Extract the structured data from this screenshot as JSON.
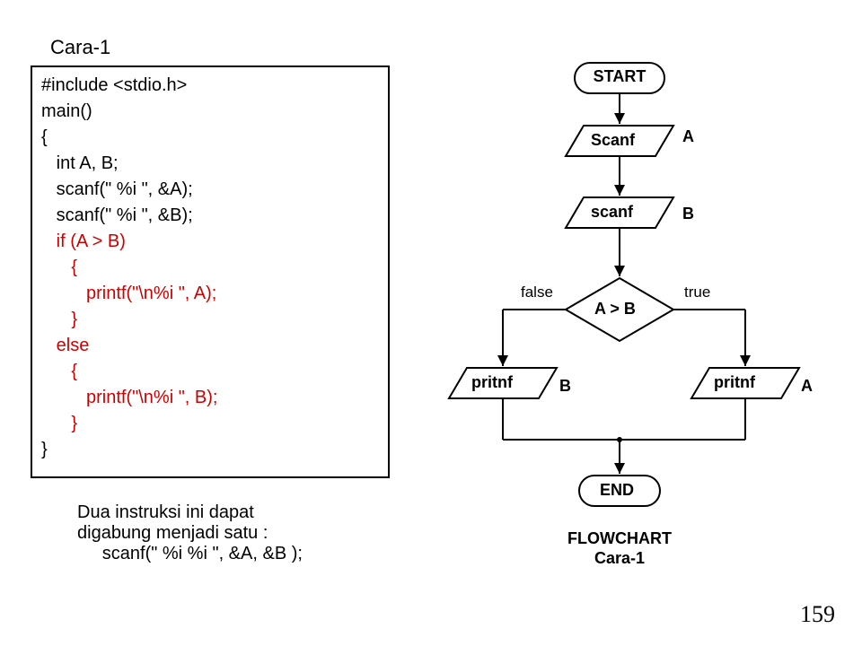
{
  "title": "Cara-1",
  "code_lines": [
    {
      "t": "#include <stdio.h>",
      "red": false,
      "indent": 0
    },
    {
      "t": "main()",
      "red": false,
      "indent": 0
    },
    {
      "t": "{",
      "red": false,
      "indent": 0
    },
    {
      "t": "int A, B;",
      "red": false,
      "indent": 1
    },
    {
      "t": "scanf(\" %i \", &A);",
      "red": false,
      "indent": 1
    },
    {
      "t": "scanf(\" %i \", &B);",
      "red": false,
      "indent": 1
    },
    {
      "t": "if (A > B)",
      "red": true,
      "indent": 1
    },
    {
      "t": "{",
      "red": true,
      "indent": 2
    },
    {
      "t": "printf(\"\\n%i \", A);",
      "red": true,
      "indent": 3
    },
    {
      "t": "}",
      "red": true,
      "indent": 2
    },
    {
      "t": "else",
      "red": true,
      "indent": 1
    },
    {
      "t": "{",
      "red": true,
      "indent": 2
    },
    {
      "t": "printf(\"\\n%i \", B);",
      "red": true,
      "indent": 3
    },
    {
      "t": "}",
      "red": true,
      "indent": 2
    },
    {
      "t": "}",
      "red": false,
      "indent": 0
    }
  ],
  "note": "Dua instruksi ini dapat\ndigabung menjadi satu :\n     scanf(\" %i %i \", &A, &B );",
  "flowchart": {
    "start": "START",
    "scanf1": "Scanf",
    "scanf1_var": "A",
    "scanf2": "scanf",
    "scanf2_var": "B",
    "decision": "A > B",
    "branch_false": "false",
    "branch_true": "true",
    "printf_left": "pritnf",
    "printf_left_var": "B",
    "printf_right": "pritnf",
    "printf_right_var": "A",
    "end": "END",
    "caption1": "FLOWCHART",
    "caption2": "Cara-1"
  },
  "page_number": "159"
}
